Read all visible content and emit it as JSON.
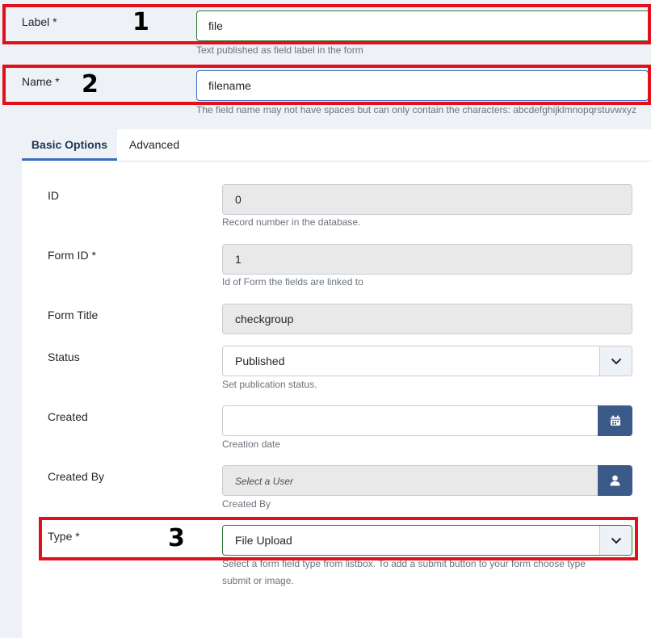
{
  "label_field": {
    "label": "Label *",
    "value": "file",
    "hint": "Text published as field label in the form"
  },
  "name_field": {
    "label": "Name *",
    "value": "filename",
    "hint": "The field name may not have spaces but can only contain the characters: abcdefghijklmnopqrstuvwxyz"
  },
  "annotations": {
    "one": "1",
    "two": "2",
    "three": "3"
  },
  "tabs": [
    {
      "label": "Basic Options",
      "active": true
    },
    {
      "label": "Advanced",
      "active": false
    }
  ],
  "form": {
    "id": {
      "label": "ID",
      "value": "0",
      "hint": "Record number in the database."
    },
    "form_id": {
      "label": "Form ID *",
      "value": "1",
      "hint": "Id of Form the fields are linked to"
    },
    "form_title": {
      "label": "Form Title",
      "value": "checkgroup"
    },
    "status": {
      "label": "Status",
      "value": "Published",
      "hint": "Set publication status."
    },
    "created": {
      "label": "Created",
      "value": "",
      "hint": "Creation date"
    },
    "created_by": {
      "label": "Created By",
      "placeholder": "Select a User",
      "hint": "Created By"
    },
    "type": {
      "label": "Type *",
      "value": "File Upload",
      "hint_line1": "Select a form field type from listbox. To add a submit button to your form choose type",
      "hint_line2": "submit or image."
    }
  },
  "icons": {
    "status_caret": "chevron-down-icon",
    "type_caret": "chevron-down-icon",
    "calendar": "calendar-icon",
    "user": "user-icon"
  },
  "colors": {
    "annotation_red": "#e2101a",
    "valid_border": "#2f7a3b",
    "addon_blue": "#3b5a8a",
    "tab_accent": "#3a6cc4"
  }
}
